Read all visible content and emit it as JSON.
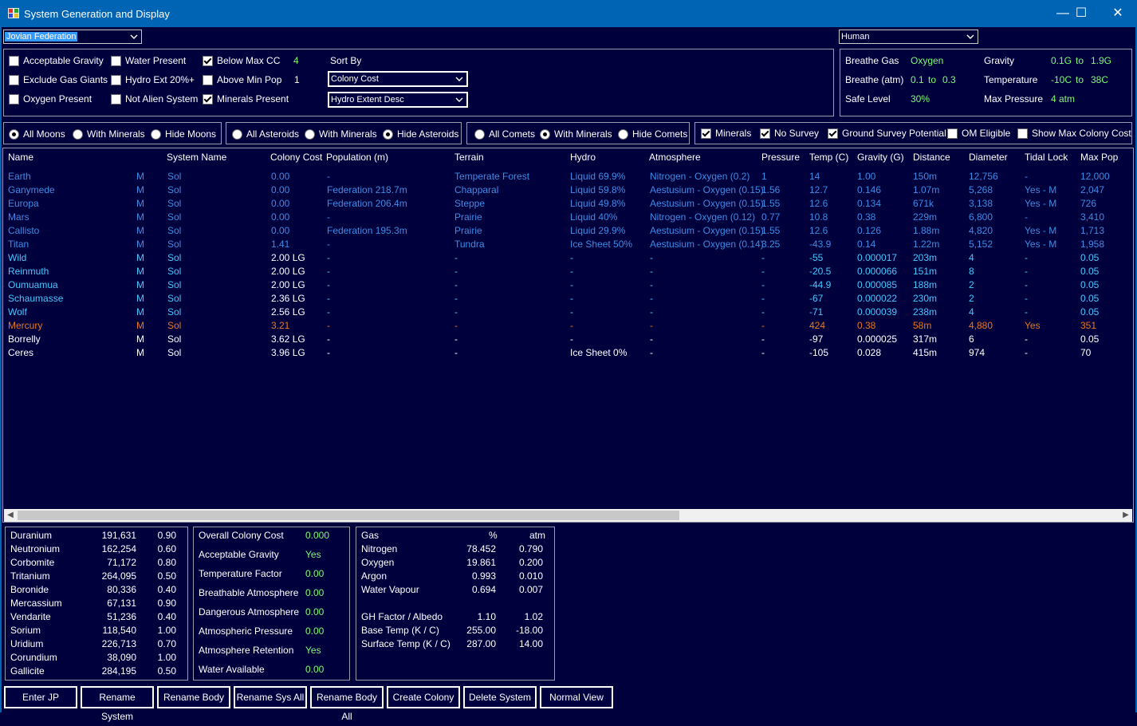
{
  "window": {
    "title": "System Generation and Display",
    "minimize": "—",
    "maximize": "☐",
    "close": "✕"
  },
  "race_select": {
    "value": "Jovian Federation"
  },
  "species_select": {
    "value": "Human"
  },
  "filters": {
    "acceptable_gravity": {
      "label": "Acceptable Gravity",
      "checked": false
    },
    "exclude_gas_giants": {
      "label": "Exclude Gas Giants",
      "checked": false
    },
    "oxygen_present": {
      "label": "Oxygen Present",
      "checked": false
    },
    "water_present": {
      "label": "Water Present",
      "checked": false
    },
    "hydro_ext": {
      "label": "Hydro Ext 20%+",
      "checked": false
    },
    "not_alien_system": {
      "label": "Not Alien System",
      "checked": false
    },
    "below_max_cc": {
      "label": "Below Max CC",
      "checked": true,
      "value": "4"
    },
    "above_min_pop": {
      "label": "Above Min Pop",
      "checked": false,
      "value": "1"
    },
    "minerals_present": {
      "label": "Minerals Present",
      "checked": true
    },
    "sort_by_label": "Sort By",
    "sort_primary": "Colony Cost",
    "sort_secondary": "Hydro Extent Desc"
  },
  "environment": {
    "breathe_gas_label": "Breathe Gas",
    "breathe_gas": "Oxygen",
    "breathe_atm_label": "Breathe (atm)",
    "breathe_atm_min": "0.1",
    "breathe_atm_to": "to",
    "breathe_atm_max": "0.3",
    "safe_level_label": "Safe Level",
    "safe_level": "30%",
    "gravity_label": "Gravity",
    "gravity_min": "0.1G",
    "gravity_to": "to",
    "gravity_max": "1.9G",
    "temperature_label": "Temperature",
    "temp_min": "-10C",
    "temp_to": "to",
    "temp_max": "38C",
    "max_pressure_label": "Max Pressure",
    "max_pressure": "4 atm"
  },
  "moons_group": {
    "all": "All Moons",
    "with_minerals": "With Minerals",
    "hide": "Hide Moons"
  },
  "asteroids_group": {
    "all": "All Asteroids",
    "with_minerals": "With Minerals",
    "hide": "Hide Asteroids"
  },
  "comets_group": {
    "all": "All Comets",
    "with_minerals": "With Minerals",
    "hide": "Hide Comets"
  },
  "options_group": {
    "minerals": {
      "label": "Minerals",
      "checked": true
    },
    "no_survey": {
      "label": "No Survey",
      "checked": true
    },
    "ground_survey": {
      "label": "Ground Survey Potential",
      "checked": true
    },
    "om_eligible": {
      "label": "OM Eligible",
      "checked": false
    },
    "show_max_cc": {
      "label": "Show Max Colony Cost",
      "checked": false
    }
  },
  "table": {
    "headers": [
      "Name",
      "System Name",
      "Colony Cost",
      "Population (m)",
      "Terrain",
      "Hydro",
      "Atmosphere",
      "Pressure",
      "Temp (C)",
      "Gravity (G)",
      "Distance",
      "Diameter",
      "Tidal Lock",
      "Max Pop"
    ],
    "rows": [
      {
        "style": "blue",
        "cells": [
          "Earth",
          "M",
          "Sol",
          "0.00",
          "-",
          "Temperate Forest",
          "Liquid 69.9%",
          "Nitrogen - Oxygen (0.2)",
          "1",
          "14",
          "1.00",
          "150m",
          "12,756",
          "-",
          "12,000"
        ]
      },
      {
        "style": "blue",
        "cells": [
          "Ganymede",
          "M",
          "Sol",
          "0.00",
          "Federation 218.7m",
          "Chapparal",
          "Liquid 59.8%",
          "Aestusium - Oxygen (0.15)",
          "1.56",
          "12.7",
          "0.146",
          "1.07m",
          "5,268",
          "Yes - M",
          "2,047"
        ]
      },
      {
        "style": "blue",
        "cells": [
          "Europa",
          "M",
          "Sol",
          "0.00",
          "Federation 206.4m",
          "Steppe",
          "Liquid 49.8%",
          "Aestusium - Oxygen (0.15)",
          "1.55",
          "12.6",
          "0.134",
          "671k",
          "3,138",
          "Yes - M",
          "726"
        ]
      },
      {
        "style": "blue",
        "cells": [
          "Mars",
          "M",
          "Sol",
          "0.00",
          "-",
          "Prairie",
          "Liquid 40%",
          "Nitrogen - Oxygen (0.12)",
          "0.77",
          "10.8",
          "0.38",
          "229m",
          "6,800",
          "-",
          "3,410"
        ]
      },
      {
        "style": "blue",
        "cells": [
          "Callisto",
          "M",
          "Sol",
          "0.00",
          "Federation 195.3m",
          "Prairie",
          "Liquid 29.9%",
          "Aestusium - Oxygen (0.15)",
          "1.55",
          "12.6",
          "0.126",
          "1.88m",
          "4,820",
          "Yes - M",
          "1,713"
        ]
      },
      {
        "style": "blue",
        "cells": [
          "Titan",
          "M",
          "Sol",
          "1.41",
          "-",
          "Tundra",
          "Ice Sheet 50%",
          "Aestusium - Oxygen (0.14)",
          "3.25",
          "-43.9",
          "0.14",
          "1.22m",
          "5,152",
          "Yes - M",
          "1,958"
        ]
      },
      {
        "style": "cyan",
        "cells": [
          "Wild",
          "M",
          "Sol",
          "2.00 LG",
          "-",
          "-",
          "-",
          "-",
          "-",
          "-55",
          "0.000017",
          "203m",
          "4",
          "-",
          "0.05"
        ]
      },
      {
        "style": "cyan",
        "cells": [
          "Reinmuth",
          "M",
          "Sol",
          "2.00 LG",
          "-",
          "-",
          "-",
          "-",
          "-",
          "-20.5",
          "0.000066",
          "151m",
          "8",
          "-",
          "0.05"
        ]
      },
      {
        "style": "cyan",
        "cells": [
          "Oumuamua",
          "M",
          "Sol",
          "2.00 LG",
          "-",
          "-",
          "-",
          "-",
          "-",
          "-44.9",
          "0.000085",
          "188m",
          "2",
          "-",
          "0.05"
        ]
      },
      {
        "style": "cyan",
        "cells": [
          "Schaumasse",
          "M",
          "Sol",
          "2.36 LG",
          "-",
          "-",
          "-",
          "-",
          "-",
          "-67",
          "0.000022",
          "230m",
          "2",
          "-",
          "0.05"
        ]
      },
      {
        "style": "cyan",
        "cells": [
          "Wolf",
          "M",
          "Sol",
          "2.56 LG",
          "-",
          "-",
          "-",
          "-",
          "-",
          "-71",
          "0.000039",
          "238m",
          "4",
          "-",
          "0.05"
        ]
      },
      {
        "style": "orange",
        "cells": [
          "Mercury",
          "M",
          "Sol",
          "3.21",
          "-",
          "-",
          "-",
          "-",
          "-",
          "424",
          "0.38",
          "58m",
          "4,880",
          "Yes",
          "351"
        ]
      },
      {
        "style": "white",
        "cells": [
          "Borrelly",
          "M",
          "Sol",
          "3.62 LG",
          "-",
          "-",
          "-",
          "-",
          "-",
          "-97",
          "0.000025",
          "317m",
          "6",
          "-",
          "0.05"
        ]
      },
      {
        "style": "white",
        "cells": [
          "Ceres",
          "M",
          "Sol",
          "3.96 LG",
          "-",
          "-",
          "Ice Sheet 0%",
          "-",
          "-",
          "-105",
          "0.028",
          "415m",
          "974",
          "-",
          "70"
        ]
      }
    ]
  },
  "minerals": [
    {
      "name": "Duranium",
      "amount": "191,631",
      "acc": "0.90"
    },
    {
      "name": "Neutronium",
      "amount": "162,254",
      "acc": "0.60"
    },
    {
      "name": "Corbomite",
      "amount": "71,172",
      "acc": "0.80"
    },
    {
      "name": "Tritanium",
      "amount": "264,095",
      "acc": "0.50"
    },
    {
      "name": "Boronide",
      "amount": "80,336",
      "acc": "0.40"
    },
    {
      "name": "Mercassium",
      "amount": "67,131",
      "acc": "0.90"
    },
    {
      "name": "Vendarite",
      "amount": "51,236",
      "acc": "0.40"
    },
    {
      "name": "Sorium",
      "amount": "118,540",
      "acc": "1.00"
    },
    {
      "name": "Uridium",
      "amount": "226,713",
      "acc": "0.70"
    },
    {
      "name": "Corundium",
      "amount": "38,090",
      "acc": "1.00"
    },
    {
      "name": "Gallicite",
      "amount": "284,195",
      "acc": "0.50"
    }
  ],
  "colony_cost": [
    {
      "label": "Overall Colony Cost",
      "value": "0.000"
    },
    {
      "label": "Acceptable Gravity",
      "value": "Yes"
    },
    {
      "label": "Temperature Factor",
      "value": "0.00"
    },
    {
      "label": "Breathable Atmosphere",
      "value": "0.00"
    },
    {
      "label": "Dangerous Atmosphere",
      "value": "0.00"
    },
    {
      "label": "Atmospheric Pressure",
      "value": "0.00"
    },
    {
      "label": "Atmosphere Retention",
      "value": "Yes"
    },
    {
      "label": "Water Available",
      "value": "0.00"
    }
  ],
  "atmosphere": {
    "header_gas": "Gas",
    "header_pct": "%",
    "header_atm": "atm",
    "gases": [
      {
        "name": "Nitrogen",
        "pct": "78.452",
        "atm": "0.790"
      },
      {
        "name": "Oxygen",
        "pct": "19.861",
        "atm": "0.200"
      },
      {
        "name": "Argon",
        "pct": "0.993",
        "atm": "0.010"
      },
      {
        "name": "Water Vapour",
        "pct": "0.694",
        "atm": "0.007"
      }
    ],
    "factors": [
      {
        "label": "GH Factor / Albedo",
        "a": "1.10",
        "b": "1.02"
      },
      {
        "label": "Base Temp (K / C)",
        "a": "255.00",
        "b": "-18.00"
      },
      {
        "label": "Surface Temp (K / C)",
        "a": "287.00",
        "b": "14.00"
      }
    ]
  },
  "buttons": [
    "Enter JP",
    "Rename System",
    "Rename Body",
    "Rename Sys All",
    "Rename Body All",
    "Create Colony",
    "Delete System",
    "Normal View"
  ]
}
